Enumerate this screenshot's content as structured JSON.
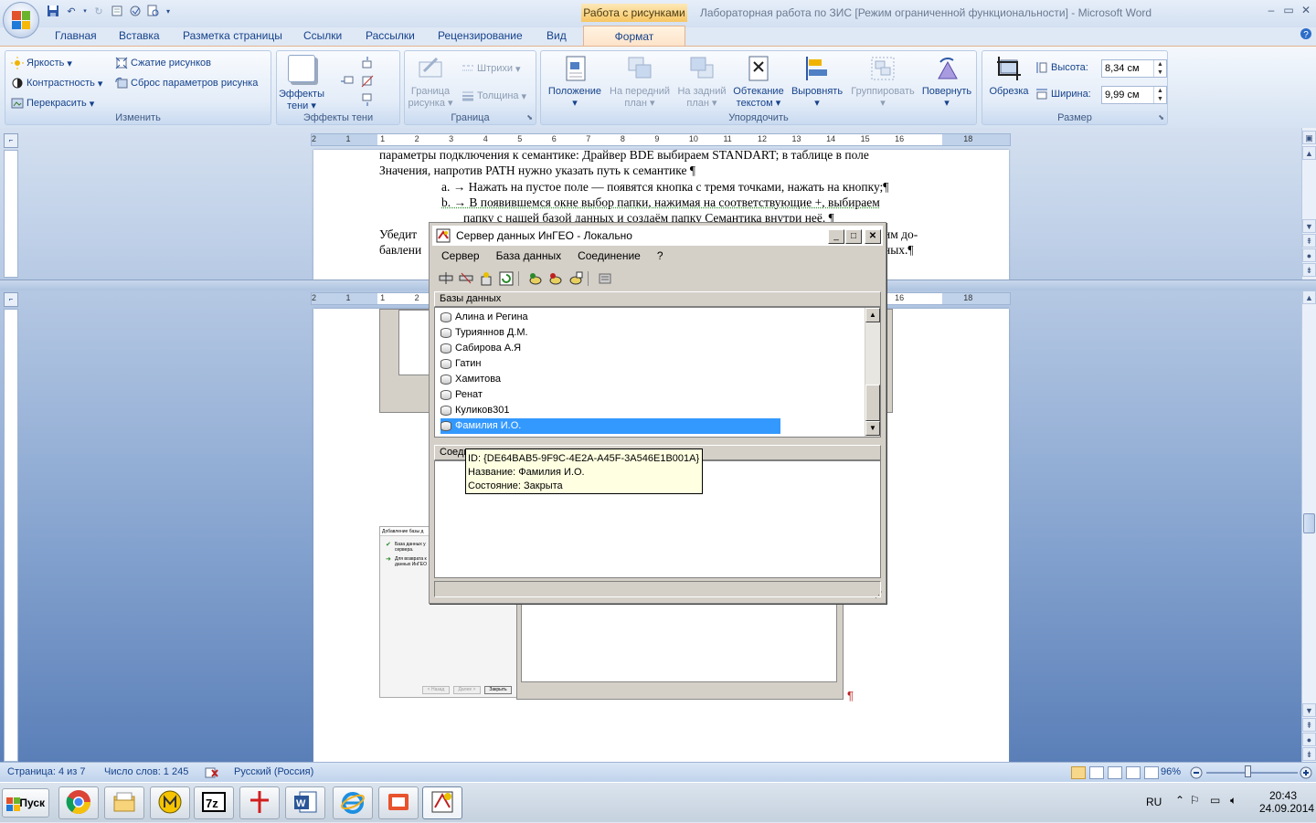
{
  "window": {
    "title": "Лабораторная работа по ЗИС [Режим ограниченной функциональности] - Microsoft Word",
    "context_tab": "Работа с рисунками"
  },
  "tabs": [
    "Главная",
    "Вставка",
    "Разметка страницы",
    "Ссылки",
    "Рассылки",
    "Рецензирование",
    "Вид",
    "Формат"
  ],
  "ribbon": {
    "izmenit": {
      "label": "Изменить",
      "brightness": "Яркость",
      "contrast": "Контрастность",
      "recolor": "Перекрасить",
      "compress": "Сжатие рисунков",
      "reset": "Сброс параметров рисунка"
    },
    "shadow": {
      "label": "Эффекты тени",
      "effects_l1": "Эффекты",
      "effects_l2": "тени"
    },
    "border": {
      "label": "Граница",
      "border_l1": "Граница",
      "border_l2": "рисунка",
      "dashes": "Штрихи",
      "weight": "Толщина"
    },
    "arrange": {
      "label": "Упорядочить",
      "position": "Положение",
      "front_l1": "На передний",
      "front_l2": "план",
      "back_l1": "На задний",
      "back_l2": "план",
      "wrap_l1": "Обтекание",
      "wrap_l2": "текстом",
      "align": "Выровнять",
      "group": "Группировать",
      "rotate": "Повернуть"
    },
    "size": {
      "label": "Размер",
      "crop": "Обрезка",
      "height_label": "Высота:",
      "height_value": "8,34 см",
      "width_label": "Ширина:",
      "width_value": "9,99 см"
    }
  },
  "ruler_top": [
    "2",
    "1",
    "1",
    "2",
    "3",
    "4",
    "5",
    "6",
    "7",
    "8",
    "9",
    "10",
    "11",
    "12",
    "13",
    "14",
    "15",
    "16",
    "18"
  ],
  "ruler_bottom": [
    "2",
    "1",
    "1",
    "2",
    "3",
    "4",
    "5",
    "6",
    "7",
    "8",
    "9",
    "10",
    "11",
    "12",
    "13",
    "14",
    "15",
    "16",
    "18"
  ],
  "document": {
    "line1": "параметры подключения к семантике: Драйвер BDE выбираем STANDART; в таблице в поле",
    "line2": "Значения, напротив PATH нужно указать путь к семантике ¶",
    "item_a": "a. → Нажать на пустое поле — появятся кнопка с тремя точками, нажать на кнопку;¶",
    "item_b": "b. → В появившемся окне выбор папки, нажимая на соответствующие +, выбираем",
    "item_b2": "папку с нашей базой данных и создаём папку Семантика внутри неё. ¶",
    "line3_left": "Убедит",
    "line3_right": "им до-",
    "line4_left": "бавлени",
    "line4_right": "ных.¶",
    "pilcrow": "¶"
  },
  "embedded_wizard": {
    "title": "Добавление базы д",
    "line1": "База данных у",
    "line2": "сервера.",
    "line3": "Для возврата к",
    "line4": "данных ИнГЕО",
    "btn_back": "< Назад",
    "btn_next": "Далее >",
    "btn_cancel": "Закрыть"
  },
  "dialog": {
    "title": "Сервер данных ИнГЕО - Локально",
    "menu": [
      "Сервер",
      "База данных",
      "Соединение",
      "?"
    ],
    "list_header": "Базы данных",
    "databases": [
      "Алина и Регина",
      "Турияннов Д.М.",
      "Сабирова А.Я",
      "Гатин",
      "Хамитова",
      "Ренат",
      "Куликов301",
      "Фамилия И.О."
    ],
    "conn_header": "Соеди",
    "tooltip": {
      "id": "ID: {DE64BAB5-9F9C-4E2A-A45F-3A546E1B001A}",
      "name": "Название: Фамилия И.О.",
      "state": "Состояние: Закрыта"
    }
  },
  "statusbar": {
    "page": "Страница: 4 из 7",
    "words": "Число слов: 1 245",
    "language": "Русский (Россия)",
    "zoom": "96%"
  },
  "taskbar": {
    "start": "Пуск",
    "lang": "RU",
    "time": "20:43",
    "date": "24.09.2014"
  },
  "colors": {
    "accent": "#15428b",
    "selection": "#3399ff",
    "tooltip_bg": "#ffffe1",
    "context": "#f7c663"
  }
}
